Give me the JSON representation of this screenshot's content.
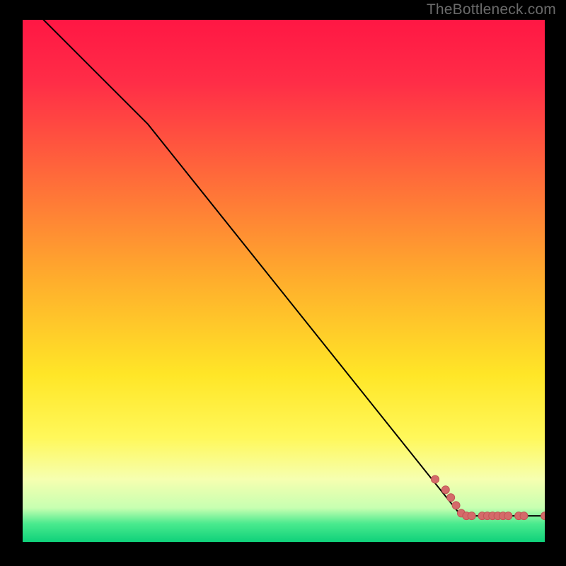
{
  "watermark": "TheBottleneck.com",
  "chart_data": {
    "type": "line",
    "title": "",
    "xlabel": "",
    "ylabel": "",
    "xlim": [
      0,
      100
    ],
    "ylim": [
      0,
      100
    ],
    "grid": false,
    "series": [
      {
        "name": "curve",
        "style": "line-black",
        "x": [
          4,
          24,
          84,
          100
        ],
        "y": [
          100,
          80,
          5,
          5
        ]
      },
      {
        "name": "markers",
        "style": "points-salmon",
        "x": [
          79,
          81,
          82,
          83,
          84,
          85,
          86,
          88,
          89,
          90,
          91,
          92,
          93,
          95,
          96,
          100
        ],
        "y": [
          12,
          10,
          8.5,
          7,
          5.5,
          5,
          5,
          5,
          5,
          5,
          5,
          5,
          5,
          5,
          5,
          5
        ]
      }
    ],
    "background_gradient": {
      "stops": [
        {
          "pos": 0.0,
          "color": "#ff1744"
        },
        {
          "pos": 0.12,
          "color": "#ff2d47"
        },
        {
          "pos": 0.3,
          "color": "#ff6a3a"
        },
        {
          "pos": 0.5,
          "color": "#ffae2c"
        },
        {
          "pos": 0.68,
          "color": "#ffe627"
        },
        {
          "pos": 0.8,
          "color": "#fff85a"
        },
        {
          "pos": 0.88,
          "color": "#f6ffb0"
        },
        {
          "pos": 0.935,
          "color": "#c7ffb1"
        },
        {
          "pos": 0.965,
          "color": "#4aea8e"
        },
        {
          "pos": 1.0,
          "color": "#0fd17a"
        }
      ]
    },
    "colors": {
      "curve": "#000000",
      "marker_fill": "#d46a6a",
      "marker_stroke": "#c25555"
    }
  }
}
